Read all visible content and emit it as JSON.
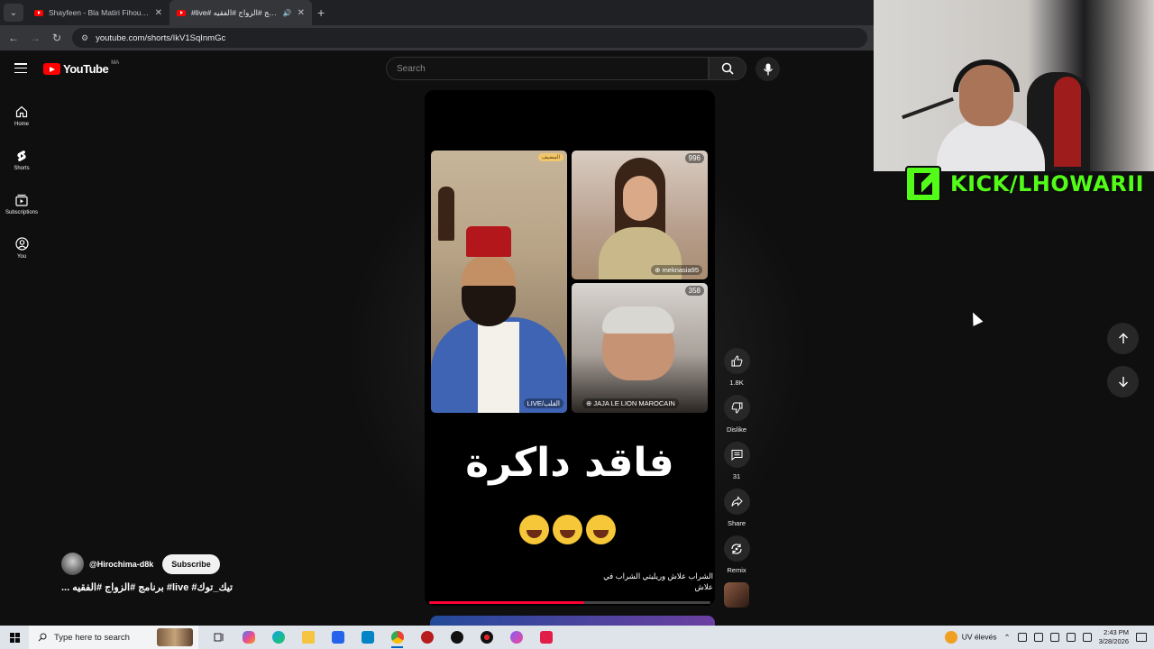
{
  "browser": {
    "tabs": [
      {
        "title": "Shayfeen - Bla Matiri Fihoum (I",
        "active": false
      },
      {
        "title": "#live# برنامج #الزواج #الفقيه",
        "active": true
      }
    ],
    "url": "youtube.com/shorts/IkV1SqInmGc"
  },
  "youtube": {
    "logo_text": "YouTube",
    "region": "MA",
    "search_placeholder": "Search",
    "nav": [
      {
        "label": "Home",
        "icon": "home-icon"
      },
      {
        "label": "Shorts",
        "icon": "shorts-icon"
      },
      {
        "label": "Subscriptions",
        "icon": "subscriptions-icon"
      },
      {
        "label": "You",
        "icon": "account-icon"
      }
    ]
  },
  "short": {
    "tiles": {
      "host_badge": "المضيف",
      "host_label": "LIVE/القلب",
      "guest2_count": "996",
      "guest2_name": "meknasia95",
      "guest3_count": "358",
      "guest3_name": "JAJA LE LION MAROCAIN"
    },
    "overlay_text": "فاقد داكرة",
    "caption": "الشراب علاش وريليتي الشراب في علاش",
    "progress": 0.55,
    "channel": "@Hirochima-d8k",
    "subscribe_label": "Subscribe",
    "title": "... برنامج #الزواج #الفقيه #live #تيك_توك"
  },
  "actions": {
    "like_count": "1.8K",
    "dislike_label": "Dislike",
    "comment_count": "31",
    "share_label": "Share",
    "remix_label": "Remix"
  },
  "stream_overlay": {
    "kick_text": "KICK/LHOWARII"
  },
  "taskbar": {
    "search_placeholder": "Type here to search",
    "weather": "UV élevés",
    "time": "2:43 PM",
    "date": "3/28/2026"
  },
  "colors": {
    "yt_red": "#ff0000",
    "kick_green": "#53fc18",
    "bg": "#0f0f0f"
  }
}
